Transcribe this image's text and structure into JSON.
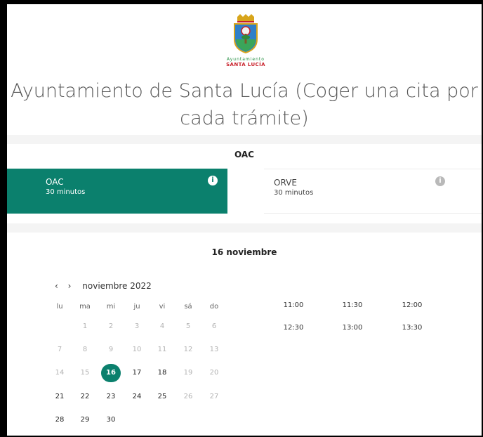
{
  "logo": {
    "line1": "Ayuntamiento",
    "line2": "SANTA LUCÍA"
  },
  "title": "Ayuntamiento de Santa Lucía (Coger una cita por cada trámite)",
  "section_label": "OAC",
  "services": [
    {
      "name": "OAC",
      "duration": "30 minutos",
      "info": "i"
    },
    {
      "name": "ORVE",
      "duration": "30 minutos",
      "info": "i"
    }
  ],
  "selected_date_label": "16 noviembre",
  "calendar": {
    "prev": "‹",
    "next": "›",
    "month": "noviembre 2022",
    "weekdays": [
      "lu",
      "ma",
      "mi",
      "ju",
      "vi",
      "sá",
      "do"
    ],
    "rows": [
      [
        "",
        "1",
        "2",
        "3",
        "4",
        "5",
        "6"
      ],
      [
        "7",
        "8",
        "9",
        "10",
        "11",
        "12",
        "13"
      ],
      [
        "14",
        "15",
        "16",
        "17",
        "18",
        "19",
        "20"
      ],
      [
        "21",
        "22",
        "23",
        "24",
        "25",
        "26",
        "27"
      ],
      [
        "28",
        "29",
        "30",
        "",
        "",
        "",
        ""
      ]
    ]
  },
  "time_slots": [
    "11:00",
    "11:30",
    "12:00",
    "12:30",
    "13:00",
    "13:30"
  ],
  "colors": {
    "accent": "#0b806d",
    "band": "#f4f4f4",
    "info_gray": "#b9b9b9"
  }
}
